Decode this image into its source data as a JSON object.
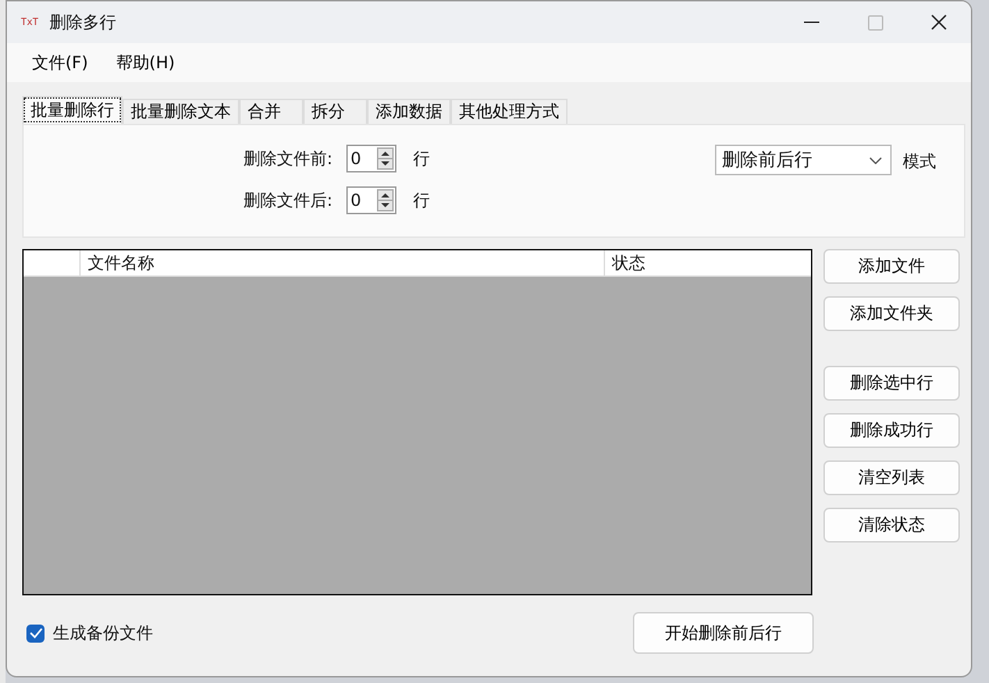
{
  "window": {
    "title": "删除多行",
    "icon_text": "TxT"
  },
  "menu": [
    {
      "label": "文件(F)"
    },
    {
      "label": "帮助(H)"
    }
  ],
  "tabs": [
    {
      "label": "批量删除行",
      "selected": true
    },
    {
      "label": "批量删除文本",
      "selected": false
    },
    {
      "label": "合并",
      "selected": false
    },
    {
      "label": "拆分",
      "selected": false
    },
    {
      "label": "添加数据",
      "selected": false
    },
    {
      "label": "其他处理方式",
      "selected": false
    }
  ],
  "spinners": [
    {
      "label": "删除文件前:",
      "value": "0",
      "unit": "行"
    },
    {
      "label": "删除文件后:",
      "value": "0",
      "unit": "行"
    }
  ],
  "mode": {
    "value": "删除前后行",
    "label": "模式"
  },
  "table": {
    "columns": [
      {
        "label": "文件名称"
      },
      {
        "label": "状态"
      }
    ]
  },
  "side_button_groups": [
    {
      "buttons": [
        "添加文件",
        "添加文件夹"
      ]
    },
    {
      "buttons": [
        "删除选中行",
        "删除成功行",
        "清空列表",
        "清除状态"
      ]
    }
  ],
  "backup": {
    "label": "生成备份文件",
    "checked": true
  },
  "start_button": "开始删除前后行"
}
